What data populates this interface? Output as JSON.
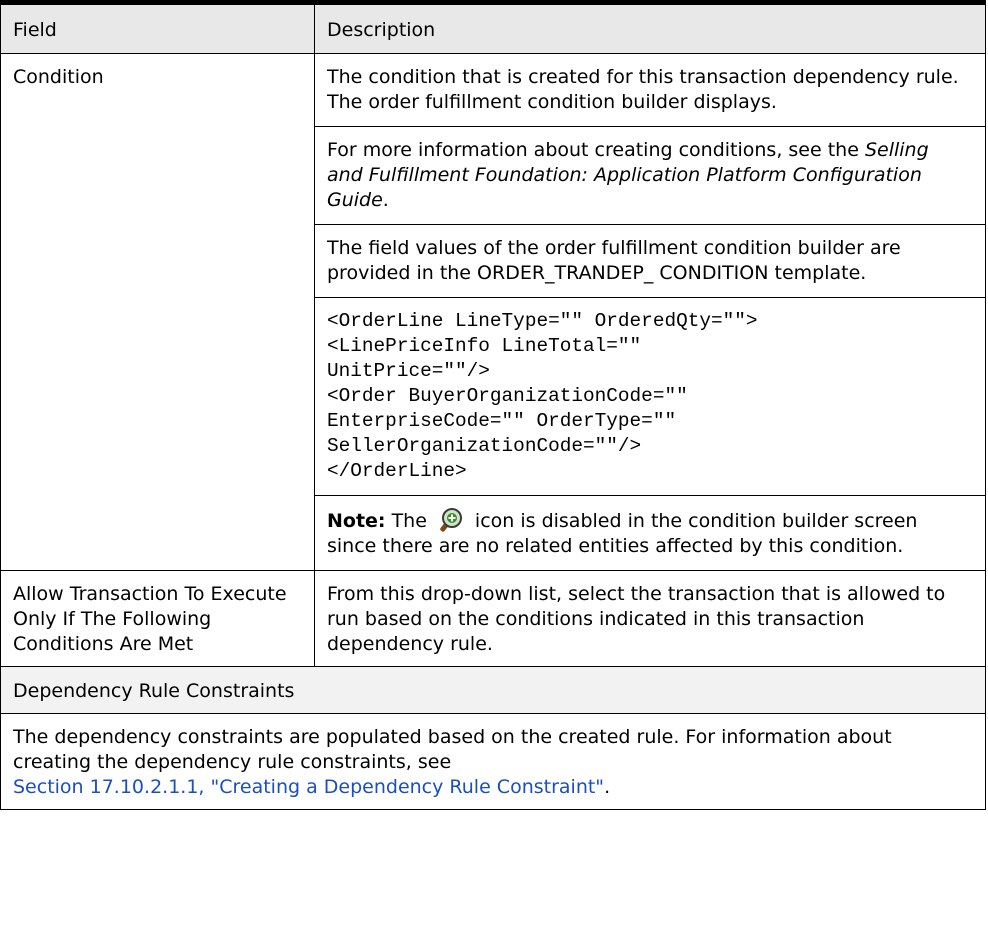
{
  "header": {
    "field": "Field",
    "description": "Description"
  },
  "condition_row": {
    "field": "Condition",
    "p1": "The condition that is created for this transaction dependency rule. The order fulfillment condition builder displays.",
    "p2_prefix": "For more information about creating conditions, see the ",
    "p2_title": "Selling and Fulfillment Foundation: Application Platform Configuration Guide",
    "p2_suffix": ".",
    "p3": "The field values of the order fulfillment condition builder are provided in the ORDER_TRANDEP_ CONDITION template.",
    "code_lines": [
      "<OrderLine LineType=\"\" OrderedQty=\"\">",
      "<LinePriceInfo LineTotal=\"\"",
      "UnitPrice=\"\"/>",
      "<Order BuyerOrganizationCode=\"\"",
      "EnterpriseCode=\"\" OrderType=\"\"",
      "SellerOrganizationCode=\"\"/>",
      "</OrderLine>"
    ],
    "note_label": "Note:",
    "note_before_icon": "The",
    "note_after_icon": "icon is disabled in the condition builder screen since there are no related entities affected by this condition.",
    "note_icon": "magnifier-plus-icon"
  },
  "allow_row": {
    "field": "Allow Transaction To Execute Only If The Following Conditions Are Met",
    "description": "From this drop-down list, select the transaction that is allowed to run based on the conditions indicated in this transaction dependency rule."
  },
  "section": {
    "title": "Dependency Rule Constraints",
    "text": "The dependency constraints are populated based on the created rule. For information about creating the dependency rule constraints, see",
    "link": "Section 17.10.2.1.1, \"Creating a Dependency Rule Constraint\"",
    "link_suffix": "."
  },
  "colors": {
    "link": "#1a4fbf",
    "header_bg": "#e8e8e8"
  }
}
